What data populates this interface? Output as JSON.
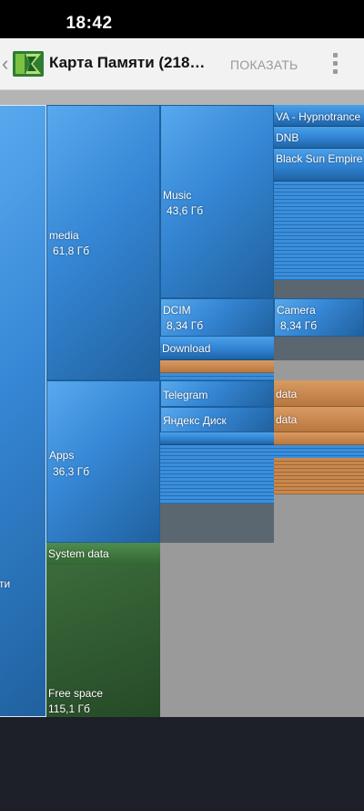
{
  "status": {
    "time": "18:42"
  },
  "appbar": {
    "back_icon": "chevron-left-icon",
    "logo_icon": "app-logo-icon",
    "title": "Карта Памяти (218…",
    "show_label": "ПОКАЗАТЬ",
    "menu_icon": "more-vert-icon"
  },
  "colors": {
    "folder_blue": "#3586d4",
    "file_orange": "#c9874c",
    "system_green": "#336633",
    "free_green": "#2e5a2f",
    "unknown_gray": "#9a9a9a"
  },
  "treemap": {
    "root": {
      "label": "ти"
    },
    "media": {
      "label": "media",
      "size": "61,8 Гб"
    },
    "music": {
      "label": "Music",
      "size": "43,6 Гб"
    },
    "hypnotrance": {
      "label": "VA - Hypnotrance"
    },
    "dnb": {
      "label": "DNB"
    },
    "black_sun": {
      "label": "Black Sun Empire"
    },
    "dcim": {
      "label": "DCIM",
      "size": "8,34 Гб"
    },
    "camera": {
      "label": "Camera",
      "size": "8,34 Гб"
    },
    "download": {
      "label": "Download"
    },
    "apps": {
      "label": "Apps",
      "size": "36,3 Гб"
    },
    "telegram": {
      "label": "Telegram"
    },
    "telegram_data": {
      "label": "data"
    },
    "yandex": {
      "label": "Яндекс Диск"
    },
    "yandex_data": {
      "label": "data"
    },
    "system_data": {
      "label": "System data"
    },
    "free_space": {
      "label": "Free space",
      "size": "115,1 Гб"
    }
  }
}
